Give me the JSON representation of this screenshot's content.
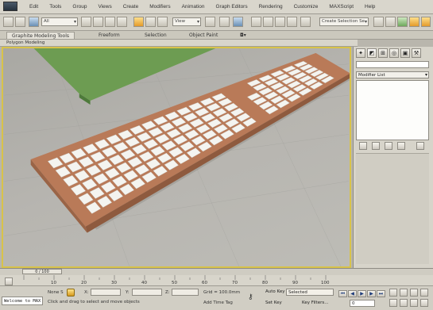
{
  "menubar": {
    "items": [
      "Edit",
      "Tools",
      "Group",
      "Views",
      "Create",
      "Modifiers",
      "Animation",
      "Graph Editors",
      "Rendering",
      "Customize",
      "MAXScript",
      "Help"
    ]
  },
  "toolbar": {
    "filter_value": "All",
    "view_value": "View",
    "selection_set_placeholder": "Create Selection Se"
  },
  "ribbon": {
    "tabs": [
      "Graphite Modeling Tools",
      "Freeform",
      "Selection",
      "Object Paint"
    ],
    "panel_label": "Polygon Modeling"
  },
  "command_panel": {
    "modifier_list_label": "Modifier List"
  },
  "timeline": {
    "frame_counter": "0 / 100",
    "ticks": [
      "10",
      "20",
      "30",
      "40",
      "50",
      "60",
      "70",
      "80",
      "90",
      "100"
    ]
  },
  "status": {
    "listener_text": "Welcome to MAX",
    "selection": "None S",
    "prompt": "Click and drag to select and move objects",
    "x_label": "X:",
    "y_label": "Y:",
    "z_label": "Z:",
    "grid": "Grid = 100.0mm",
    "add_time_tag": "Add Time Tag",
    "auto_key": "Auto Key",
    "set_key": "Set Key",
    "selected_option": "Selected",
    "key_filters": "Key Filters...",
    "current_frame": "0"
  },
  "colors": {
    "viewport_border": "#d8c34a",
    "keyboard_body": "#b97a58",
    "keycap": "#f4f4f0",
    "mat": "#6d9c52"
  }
}
